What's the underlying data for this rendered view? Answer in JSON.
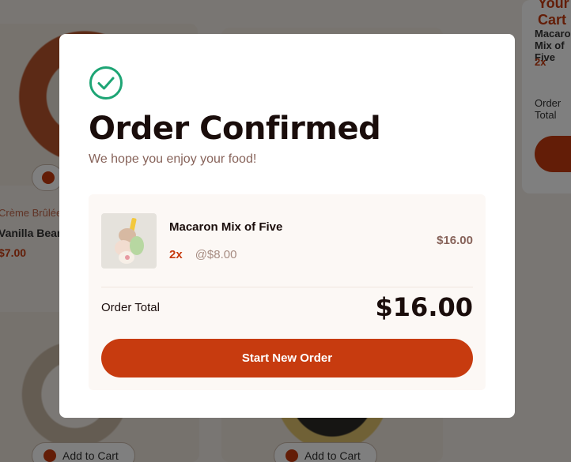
{
  "background": {
    "products": [
      {
        "category": "Crème Brûlée",
        "name": "Vanilla Bean Crème Brûlée",
        "price": "$7.00"
      }
    ],
    "add_to_cart_label": "Add to Cart",
    "cart": {
      "title": "Your Cart",
      "item_name": "Macaron Mix of Five",
      "item_qty": "2x",
      "order_total_label": "Order Total"
    }
  },
  "modal": {
    "check_icon": "circle-check-icon",
    "title": "Order Confirmed",
    "subtitle": "We hope you enjoy your food!",
    "items": [
      {
        "name": "Macaron Mix of Five",
        "quantity": "2x",
        "unit_price": "@$8.00",
        "line_total": "$16.00",
        "thumbnail": "macaron-thumbnail"
      }
    ],
    "order_total_label": "Order Total",
    "order_total": "$16.00",
    "start_new_order_label": "Start New Order"
  },
  "colors": {
    "accent": "#c73b0f",
    "success": "#1ea575",
    "text_dark": "#1a0d0b",
    "text_muted": "#87635a",
    "summary_bg": "#fcf8f5"
  }
}
